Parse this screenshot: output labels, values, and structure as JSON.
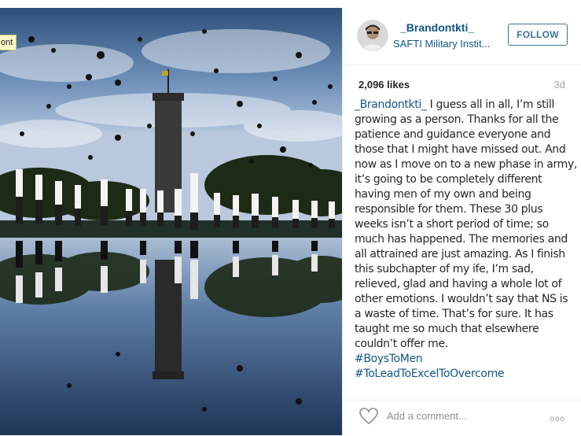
{
  "tooltip": {
    "text": "ont"
  },
  "post": {
    "username": "_Brandontkti_",
    "location": "SAFTI Military Instit...",
    "follow_label": "FOLLOW",
    "likes": "2,096 likes",
    "time_ago": "3d",
    "caption": {
      "author": "_Brandontkti_",
      "text": " I guess all in all, I’m still growing as a person. Thanks for all the patience and guidance everyone and those that I might have missed out. And now as I move on to a new phase in army, it’s going to be completely different having men of my own and being responsible for them. These 30 plus weeks isn’t a short period of time; so much has happened. The memories and all attrained are just amazing. As I finish this subchapter of my ife, I’m sad, relieved, glad and having a whole lot of other emotions. I wouldn’t say that NS is a waste of time. That’s for sure. It has taught me so much that elsewhere couldn’t offer me.",
      "hashtags": [
        "#BoysToMen",
        "#ToLeadToExcelToOvercome"
      ]
    },
    "comment_placeholder": "Add a comment...",
    "more_label": "ooo"
  },
  "icons": {
    "heart": "heart-icon",
    "more": "more-options-icon",
    "avatar": "avatar"
  },
  "colors": {
    "link": "#125688",
    "follow": "#3f729b",
    "muted": "#a5a7aa"
  }
}
